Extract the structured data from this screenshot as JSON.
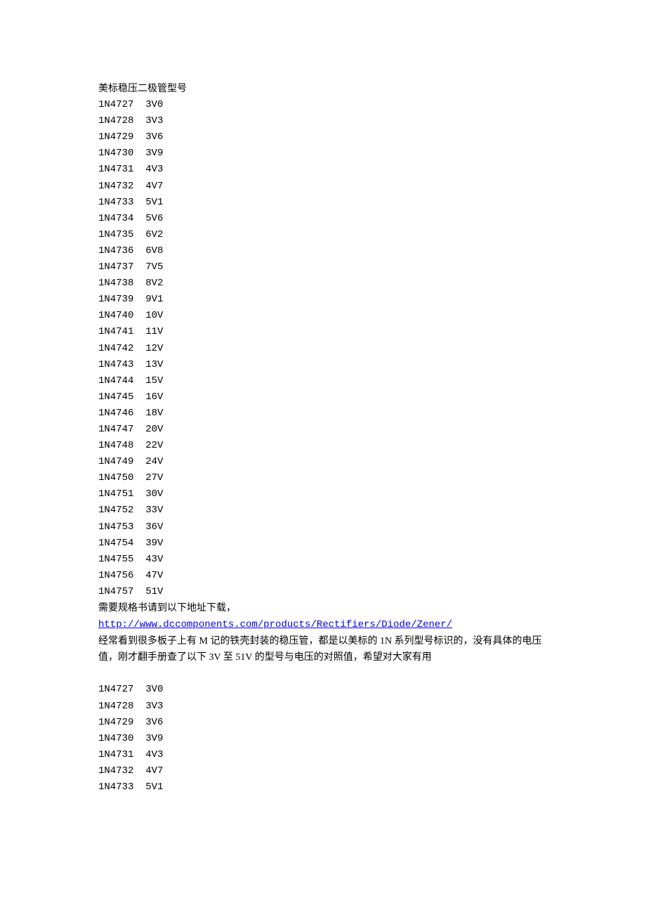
{
  "title": "美标稳压二极管型号",
  "diodes_section1": [
    {
      "model": "1N4727",
      "voltage": "3V0"
    },
    {
      "model": "1N4728",
      "voltage": "3V3"
    },
    {
      "model": "1N4729",
      "voltage": "3V6"
    },
    {
      "model": "1N4730",
      "voltage": "3V9"
    },
    {
      "model": "1N4731",
      "voltage": "4V3"
    },
    {
      "model": "1N4732",
      "voltage": "4V7"
    },
    {
      "model": "1N4733",
      "voltage": "5V1"
    },
    {
      "model": "1N4734",
      "voltage": "5V6"
    },
    {
      "model": "1N4735",
      "voltage": "6V2"
    },
    {
      "model": "1N4736",
      "voltage": "6V8"
    },
    {
      "model": "1N4737",
      "voltage": "7V5"
    },
    {
      "model": "1N4738",
      "voltage": "8V2"
    },
    {
      "model": "1N4739",
      "voltage": "9V1"
    },
    {
      "model": "1N4740",
      "voltage": "10V"
    },
    {
      "model": "1N4741",
      "voltage": "11V"
    },
    {
      "model": "1N4742",
      "voltage": "12V"
    },
    {
      "model": "1N4743",
      "voltage": "13V"
    },
    {
      "model": "1N4744",
      "voltage": "15V"
    },
    {
      "model": "1N4745",
      "voltage": "16V"
    },
    {
      "model": "1N4746",
      "voltage": "18V"
    },
    {
      "model": "1N4747",
      "voltage": "20V"
    },
    {
      "model": "1N4748",
      "voltage": "22V"
    },
    {
      "model": "1N4749",
      "voltage": "24V"
    },
    {
      "model": "1N4750",
      "voltage": "27V"
    },
    {
      "model": "1N4751",
      "voltage": "30V"
    },
    {
      "model": "1N4752",
      "voltage": "33V"
    },
    {
      "model": "1N4753",
      "voltage": "36V"
    },
    {
      "model": "1N4754",
      "voltage": "39V"
    },
    {
      "model": "1N4755",
      "voltage": "43V"
    },
    {
      "model": "1N4756",
      "voltage": "47V"
    },
    {
      "model": "1N4757",
      "voltage": "51V"
    }
  ],
  "download_text": "需要规格书请到以下地址下载，",
  "link_url": "http://www.dccomponents.com/products/Rectifiers/Diode/Zener/",
  "description": "经常看到很多板子上有 M 记的铁壳封装的稳压管，都是以美标的 1N 系列型号标识的，没有具体的电压值，刚才翻手册查了以下 3V 至 51V 的型号与电压的对照值，希望对大家有用",
  "diodes_section2": [
    {
      "model": "1N4727",
      "voltage": "3V0"
    },
    {
      "model": "1N4728",
      "voltage": "3V3"
    },
    {
      "model": "1N4729",
      "voltage": "3V6"
    },
    {
      "model": "1N4730",
      "voltage": "3V9"
    },
    {
      "model": "1N4731",
      "voltage": "4V3"
    },
    {
      "model": "1N4732",
      "voltage": "4V7"
    },
    {
      "model": "1N4733",
      "voltage": "5V1"
    }
  ]
}
